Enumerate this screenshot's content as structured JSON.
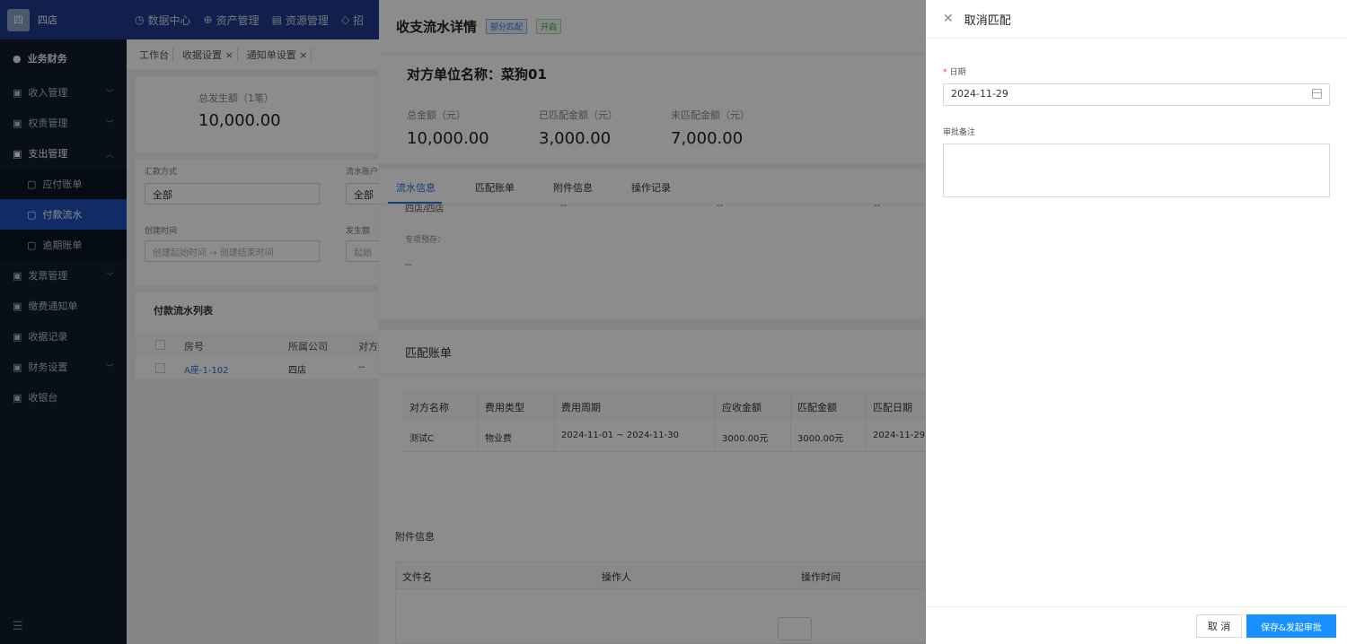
{
  "app": {
    "logo_text": "四",
    "store_name": "四店"
  },
  "topnav": [
    "数据中心",
    "资产管理",
    "资源管理",
    "招"
  ],
  "sidebar": {
    "header": "业务财务",
    "items": [
      {
        "label": "收入管理",
        "chevron": "chevron-down"
      },
      {
        "label": "权责管理",
        "chevron": "chevron-down"
      },
      {
        "label": "支出管理",
        "chevron": "chevron-up"
      },
      {
        "label": "应付账单"
      },
      {
        "label": "付款流水"
      },
      {
        "label": "逾期账单"
      },
      {
        "label": "发票管理",
        "chevron": "chevron-down"
      },
      {
        "label": "缴费通知单"
      },
      {
        "label": "收据记录"
      },
      {
        "label": "财务设置",
        "chevron": "chevron-down"
      },
      {
        "label": "收银台"
      }
    ],
    "menu_toggle": "☰"
  },
  "tabsbar": [
    "工作台",
    "收据设置 ×",
    "通知单设置 ×"
  ],
  "summary": {
    "label": "总发生额（1笔）",
    "value": "10,000.00"
  },
  "filters": {
    "method_label": "汇款方式",
    "method_value": "全部",
    "account_label": "流水账户",
    "account_value": "全部",
    "created_label": "创建时间",
    "created_start": "创建起始时间",
    "created_arrow": "→",
    "created_end": "创建结束时间",
    "amount_label": "发生额",
    "amount_placeholder": "起始"
  },
  "list": {
    "title": "付款流水列表",
    "headers": [
      "房号",
      "所属公司",
      "对方账"
    ],
    "row": [
      "A座-1-102",
      "四店",
      "--"
    ]
  },
  "detail": {
    "title": "收支流水详情",
    "tags": [
      "部分匹配",
      "开启"
    ],
    "party_label": "对方单位名称：",
    "party_value": "菜狗01",
    "amounts": [
      {
        "label": "总金额（元）",
        "value": "10,000.00"
      },
      {
        "label": "已匹配金额（元）",
        "value": "3,000.00"
      },
      {
        "label": "未匹配金额（元）",
        "value": "7,000.00"
      }
    ],
    "tabs": [
      "流水信息",
      "匹配账单",
      "附件信息",
      "操作记录"
    ],
    "flow_row": [
      "四店/四店",
      "--",
      "--",
      "--"
    ],
    "special_label": "专项预存：",
    "special_value": "--",
    "match_section_title": "匹配账单",
    "match_headers": [
      "对方名称",
      "费用类型",
      "费用周期",
      "应收金额",
      "匹配金额",
      "匹配日期"
    ],
    "match_rows": [
      [
        "测试C",
        "物业费",
        "2024-11-01 ~ 2024-11-30",
        "3000.00元",
        "3000.00元",
        "2024-11-29"
      ]
    ],
    "attach_title": "附件信息",
    "attach_headers": [
      "文件名",
      "操作人",
      "操作时间"
    ]
  },
  "form": {
    "title": "取消匹配",
    "date_label": "日期",
    "date_value": "2024-11-29",
    "note_label": "审批备注",
    "note_value": "",
    "cancel_label": "取 消",
    "submit_label": "保存&发起审批"
  },
  "colors": {
    "primary": "#1890ff",
    "topbar": "#1f3a8a",
    "sidebar": "#0f1c2e"
  }
}
